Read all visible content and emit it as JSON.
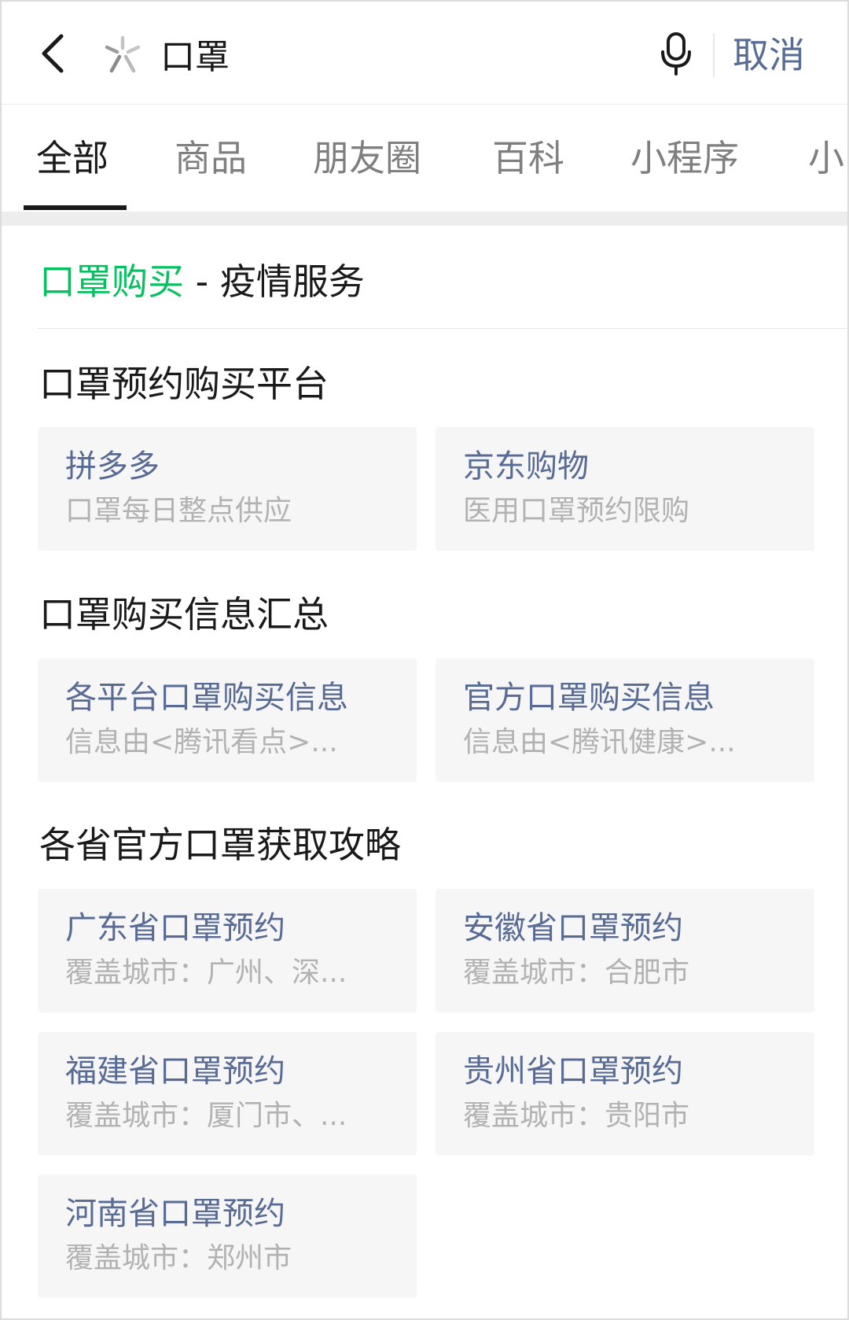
{
  "search": {
    "query": "口罩",
    "cancel_label": "取消"
  },
  "tabs": [
    {
      "label": "全部"
    },
    {
      "label": "商品"
    },
    {
      "label": "朋友圈"
    },
    {
      "label": "百科"
    },
    {
      "label": "小程序"
    },
    {
      "label": "小"
    }
  ],
  "service": {
    "highlight": "口罩购买",
    "separator": " - ",
    "suffix": "疫情服务"
  },
  "groups": [
    {
      "title": "口罩预约购买平台",
      "cards": [
        {
          "title": "拼多多",
          "subtitle": "口罩每日整点供应"
        },
        {
          "title": "京东购物",
          "subtitle": "医用口罩预约限购"
        }
      ]
    },
    {
      "title": "口罩购买信息汇总",
      "cards": [
        {
          "title": "各平台口罩购买信息",
          "subtitle": "信息由<腾讯看点>..."
        },
        {
          "title": "官方口罩购买信息",
          "subtitle": "信息由<腾讯健康>..."
        }
      ]
    },
    {
      "title": "各省官方口罩获取攻略",
      "cards": [
        {
          "title": "广东省口罩预约",
          "subtitle": "覆盖城市：广州、深..."
        },
        {
          "title": "安徽省口罩预约",
          "subtitle": "覆盖城市：合肥市"
        },
        {
          "title": "福建省口罩预约",
          "subtitle": "覆盖城市：厦门市、..."
        },
        {
          "title": "贵州省口罩预约",
          "subtitle": "覆盖城市：贵阳市"
        },
        {
          "title": "河南省口罩预约",
          "subtitle": "覆盖城市：郑州市"
        }
      ]
    }
  ],
  "colors": {
    "accent_green": "#07c160",
    "link_blue": "#576b95",
    "subtitle_gray": "#b2b2b2",
    "card_bg": "#f6f6f6"
  }
}
